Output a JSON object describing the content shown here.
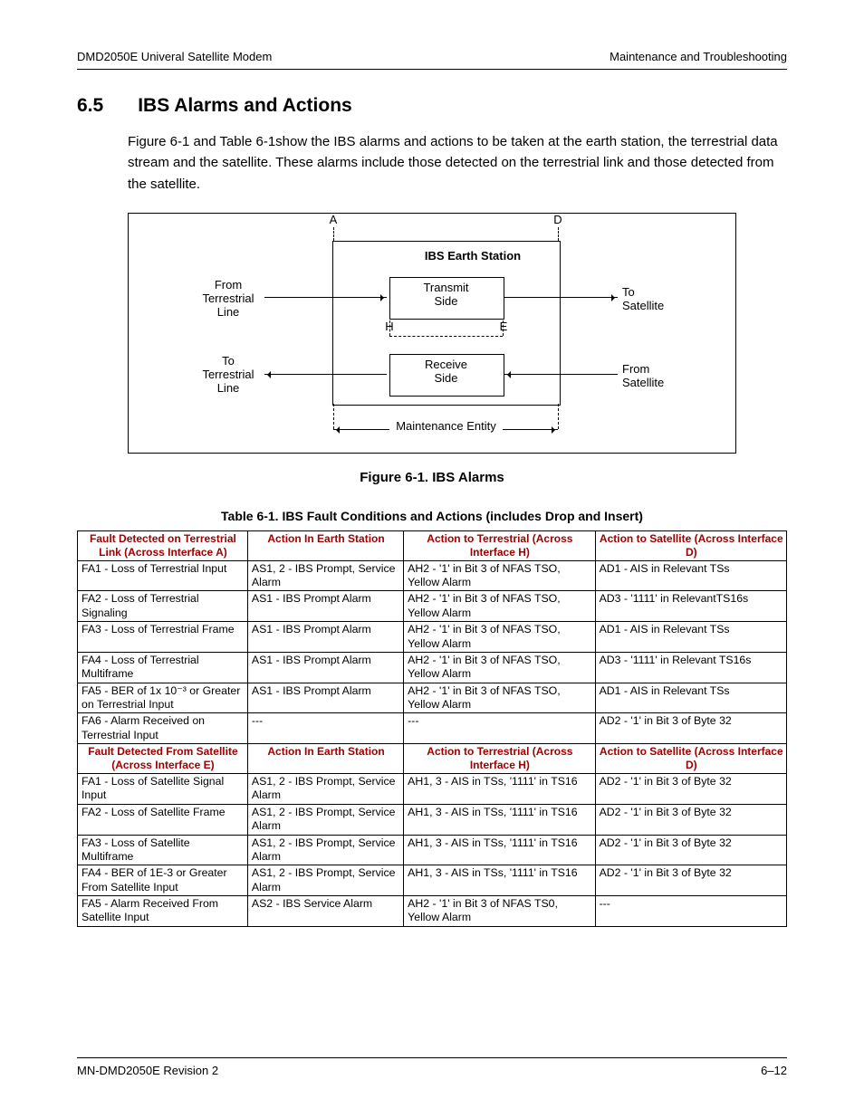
{
  "header": {
    "left": "DMD2050E Univeral Satellite Modem",
    "right": "Maintenance and Troubleshooting"
  },
  "section": {
    "num": "6.5",
    "title": "IBS Alarms and Actions",
    "para": "Figure 6-1 and Table 6-1show the IBS alarms and actions to be taken at the earth station, the terrestrial data stream and the satellite. These alarms include those detected on the terrestrial link and those detected from the satellite."
  },
  "figure": {
    "caption": "Figure 6-1.  IBS Alarms",
    "labels": {
      "A": "A",
      "D": "D",
      "H": "H",
      "E": "E",
      "title": "IBS Earth Station",
      "tx": "Transmit\nSide",
      "rx": "Receive\nSide",
      "fromTerr": "From\nTerrestrial\nLine",
      "toTerr": "To\nTerrestrial\nLine",
      "toSat": "To\nSatellite",
      "fromSat": "From\nSatellite",
      "maint": "Maintenance Entity"
    }
  },
  "table": {
    "caption": "Table 6-1. IBS Fault Conditions and Actions (includes Drop and Insert)",
    "head1": [
      "Fault Detected on Terrestrial Link (Across Interface A)",
      "Action In Earth Station",
      "Action to Terrestrial (Across Interface H)",
      "Action to Satellite (Across Interface D)"
    ],
    "rows1": [
      [
        "FA1 - Loss of Terrestrial Input",
        "AS1, 2 - IBS Prompt, Service Alarm",
        "AH2 - '1' in Bit 3 of NFAS TSO, Yellow Alarm",
        "AD1 - AIS in Relevant TSs"
      ],
      [
        "FA2 - Loss of Terrestrial Signaling",
        "AS1 - IBS Prompt Alarm",
        "AH2 - '1' in Bit 3 of NFAS TSO, Yellow Alarm",
        "AD3 - '1111' in RelevantTS16s"
      ],
      [
        "FA3 - Loss of Terrestrial Frame",
        "AS1 - IBS Prompt Alarm",
        "AH2 - '1' in Bit 3 of NFAS TSO, Yellow Alarm",
        "AD1 - AIS in Relevant TSs"
      ],
      [
        "FA4 - Loss of Terrestrial Multiframe",
        "AS1 - IBS Prompt Alarm",
        "AH2 - '1' in Bit 3 of NFAS TSO, Yellow Alarm",
        "AD3 - '1111' in Relevant TS16s"
      ],
      [
        "FA5 - BER of 1x 10⁻³ or Greater on Terrestrial Input",
        "AS1 - IBS Prompt Alarm",
        "AH2 - '1' in Bit 3 of NFAS TSO, Yellow Alarm",
        "AD1 - AIS in Relevant TSs"
      ],
      [
        "FA6 - Alarm Received on Terrestrial Input",
        "---",
        "---",
        "AD2 - '1' in Bit 3 of Byte 32"
      ]
    ],
    "head2": [
      "Fault Detected From Satellite (Across Interface E)",
      "Action In Earth Station",
      "Action to Terrestrial (Across Interface H)",
      "Action to Satellite (Across Interface D)"
    ],
    "rows2": [
      [
        "FA1 - Loss of Satellite Signal Input",
        "AS1, 2 - IBS Prompt, Service Alarm",
        "AH1, 3 - AIS in TSs, '1111' in TS16",
        "AD2 - '1' in Bit 3 of Byte 32"
      ],
      [
        "FA2 - Loss of Satellite Frame",
        "AS1, 2 - IBS Prompt, Service Alarm",
        "AH1, 3 - AIS in TSs, '1111' in TS16",
        "AD2 - '1' in Bit 3 of Byte 32"
      ],
      [
        "FA3 - Loss of Satellite Multiframe",
        "AS1, 2 - IBS Prompt, Service Alarm",
        "AH1, 3 - AIS in TSs, '1111' in TS16",
        "AD2 - '1' in Bit 3 of Byte 32"
      ],
      [
        "FA4 - BER of 1E-3 or Greater From Satellite Input",
        "AS1, 2 - IBS Prompt, Service Alarm",
        "AH1, 3 - AIS in TSs, '1111' in TS16",
        "AD2 - '1' in Bit 3 of Byte 32"
      ],
      [
        "FA5 - Alarm Received From Satellite Input",
        "AS2 - IBS Service Alarm",
        "AH2 - '1' in Bit 3 of NFAS TS0, Yellow Alarm",
        "---"
      ]
    ]
  },
  "footer": {
    "left": "MN-DMD2050E    Revision 2",
    "right": "6–12"
  }
}
